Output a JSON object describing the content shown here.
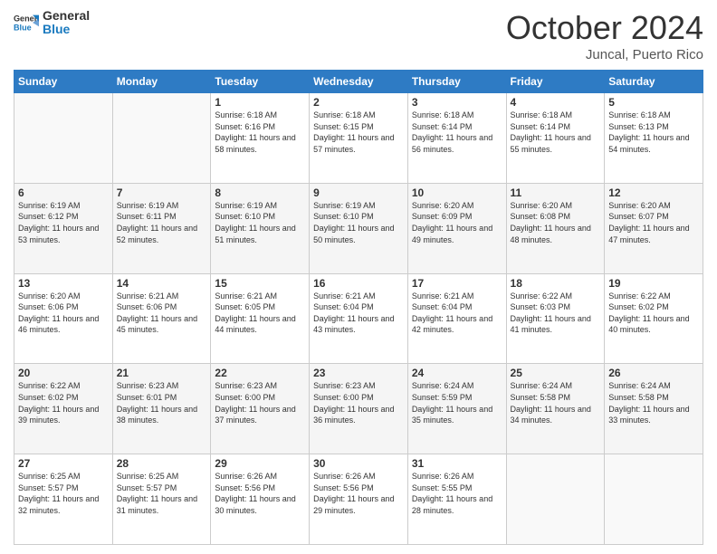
{
  "header": {
    "logo_general": "General",
    "logo_blue": "Blue",
    "month_title": "October 2024",
    "location": "Juncal, Puerto Rico"
  },
  "days_of_week": [
    "Sunday",
    "Monday",
    "Tuesday",
    "Wednesday",
    "Thursday",
    "Friday",
    "Saturday"
  ],
  "weeks": [
    [
      {
        "day": "",
        "sunrise": "",
        "sunset": "",
        "daylight": ""
      },
      {
        "day": "",
        "sunrise": "",
        "sunset": "",
        "daylight": ""
      },
      {
        "day": "1",
        "sunrise": "Sunrise: 6:18 AM",
        "sunset": "Sunset: 6:16 PM",
        "daylight": "Daylight: 11 hours and 58 minutes."
      },
      {
        "day": "2",
        "sunrise": "Sunrise: 6:18 AM",
        "sunset": "Sunset: 6:15 PM",
        "daylight": "Daylight: 11 hours and 57 minutes."
      },
      {
        "day": "3",
        "sunrise": "Sunrise: 6:18 AM",
        "sunset": "Sunset: 6:14 PM",
        "daylight": "Daylight: 11 hours and 56 minutes."
      },
      {
        "day": "4",
        "sunrise": "Sunrise: 6:18 AM",
        "sunset": "Sunset: 6:14 PM",
        "daylight": "Daylight: 11 hours and 55 minutes."
      },
      {
        "day": "5",
        "sunrise": "Sunrise: 6:18 AM",
        "sunset": "Sunset: 6:13 PM",
        "daylight": "Daylight: 11 hours and 54 minutes."
      }
    ],
    [
      {
        "day": "6",
        "sunrise": "Sunrise: 6:19 AM",
        "sunset": "Sunset: 6:12 PM",
        "daylight": "Daylight: 11 hours and 53 minutes."
      },
      {
        "day": "7",
        "sunrise": "Sunrise: 6:19 AM",
        "sunset": "Sunset: 6:11 PM",
        "daylight": "Daylight: 11 hours and 52 minutes."
      },
      {
        "day": "8",
        "sunrise": "Sunrise: 6:19 AM",
        "sunset": "Sunset: 6:10 PM",
        "daylight": "Daylight: 11 hours and 51 minutes."
      },
      {
        "day": "9",
        "sunrise": "Sunrise: 6:19 AM",
        "sunset": "Sunset: 6:10 PM",
        "daylight": "Daylight: 11 hours and 50 minutes."
      },
      {
        "day": "10",
        "sunrise": "Sunrise: 6:20 AM",
        "sunset": "Sunset: 6:09 PM",
        "daylight": "Daylight: 11 hours and 49 minutes."
      },
      {
        "day": "11",
        "sunrise": "Sunrise: 6:20 AM",
        "sunset": "Sunset: 6:08 PM",
        "daylight": "Daylight: 11 hours and 48 minutes."
      },
      {
        "day": "12",
        "sunrise": "Sunrise: 6:20 AM",
        "sunset": "Sunset: 6:07 PM",
        "daylight": "Daylight: 11 hours and 47 minutes."
      }
    ],
    [
      {
        "day": "13",
        "sunrise": "Sunrise: 6:20 AM",
        "sunset": "Sunset: 6:06 PM",
        "daylight": "Daylight: 11 hours and 46 minutes."
      },
      {
        "day": "14",
        "sunrise": "Sunrise: 6:21 AM",
        "sunset": "Sunset: 6:06 PM",
        "daylight": "Daylight: 11 hours and 45 minutes."
      },
      {
        "day": "15",
        "sunrise": "Sunrise: 6:21 AM",
        "sunset": "Sunset: 6:05 PM",
        "daylight": "Daylight: 11 hours and 44 minutes."
      },
      {
        "day": "16",
        "sunrise": "Sunrise: 6:21 AM",
        "sunset": "Sunset: 6:04 PM",
        "daylight": "Daylight: 11 hours and 43 minutes."
      },
      {
        "day": "17",
        "sunrise": "Sunrise: 6:21 AM",
        "sunset": "Sunset: 6:04 PM",
        "daylight": "Daylight: 11 hours and 42 minutes."
      },
      {
        "day": "18",
        "sunrise": "Sunrise: 6:22 AM",
        "sunset": "Sunset: 6:03 PM",
        "daylight": "Daylight: 11 hours and 41 minutes."
      },
      {
        "day": "19",
        "sunrise": "Sunrise: 6:22 AM",
        "sunset": "Sunset: 6:02 PM",
        "daylight": "Daylight: 11 hours and 40 minutes."
      }
    ],
    [
      {
        "day": "20",
        "sunrise": "Sunrise: 6:22 AM",
        "sunset": "Sunset: 6:02 PM",
        "daylight": "Daylight: 11 hours and 39 minutes."
      },
      {
        "day": "21",
        "sunrise": "Sunrise: 6:23 AM",
        "sunset": "Sunset: 6:01 PM",
        "daylight": "Daylight: 11 hours and 38 minutes."
      },
      {
        "day": "22",
        "sunrise": "Sunrise: 6:23 AM",
        "sunset": "Sunset: 6:00 PM",
        "daylight": "Daylight: 11 hours and 37 minutes."
      },
      {
        "day": "23",
        "sunrise": "Sunrise: 6:23 AM",
        "sunset": "Sunset: 6:00 PM",
        "daylight": "Daylight: 11 hours and 36 minutes."
      },
      {
        "day": "24",
        "sunrise": "Sunrise: 6:24 AM",
        "sunset": "Sunset: 5:59 PM",
        "daylight": "Daylight: 11 hours and 35 minutes."
      },
      {
        "day": "25",
        "sunrise": "Sunrise: 6:24 AM",
        "sunset": "Sunset: 5:58 PM",
        "daylight": "Daylight: 11 hours and 34 minutes."
      },
      {
        "day": "26",
        "sunrise": "Sunrise: 6:24 AM",
        "sunset": "Sunset: 5:58 PM",
        "daylight": "Daylight: 11 hours and 33 minutes."
      }
    ],
    [
      {
        "day": "27",
        "sunrise": "Sunrise: 6:25 AM",
        "sunset": "Sunset: 5:57 PM",
        "daylight": "Daylight: 11 hours and 32 minutes."
      },
      {
        "day": "28",
        "sunrise": "Sunrise: 6:25 AM",
        "sunset": "Sunset: 5:57 PM",
        "daylight": "Daylight: 11 hours and 31 minutes."
      },
      {
        "day": "29",
        "sunrise": "Sunrise: 6:26 AM",
        "sunset": "Sunset: 5:56 PM",
        "daylight": "Daylight: 11 hours and 30 minutes."
      },
      {
        "day": "30",
        "sunrise": "Sunrise: 6:26 AM",
        "sunset": "Sunset: 5:56 PM",
        "daylight": "Daylight: 11 hours and 29 minutes."
      },
      {
        "day": "31",
        "sunrise": "Sunrise: 6:26 AM",
        "sunset": "Sunset: 5:55 PM",
        "daylight": "Daylight: 11 hours and 28 minutes."
      },
      {
        "day": "",
        "sunrise": "",
        "sunset": "",
        "daylight": ""
      },
      {
        "day": "",
        "sunrise": "",
        "sunset": "",
        "daylight": ""
      }
    ]
  ]
}
